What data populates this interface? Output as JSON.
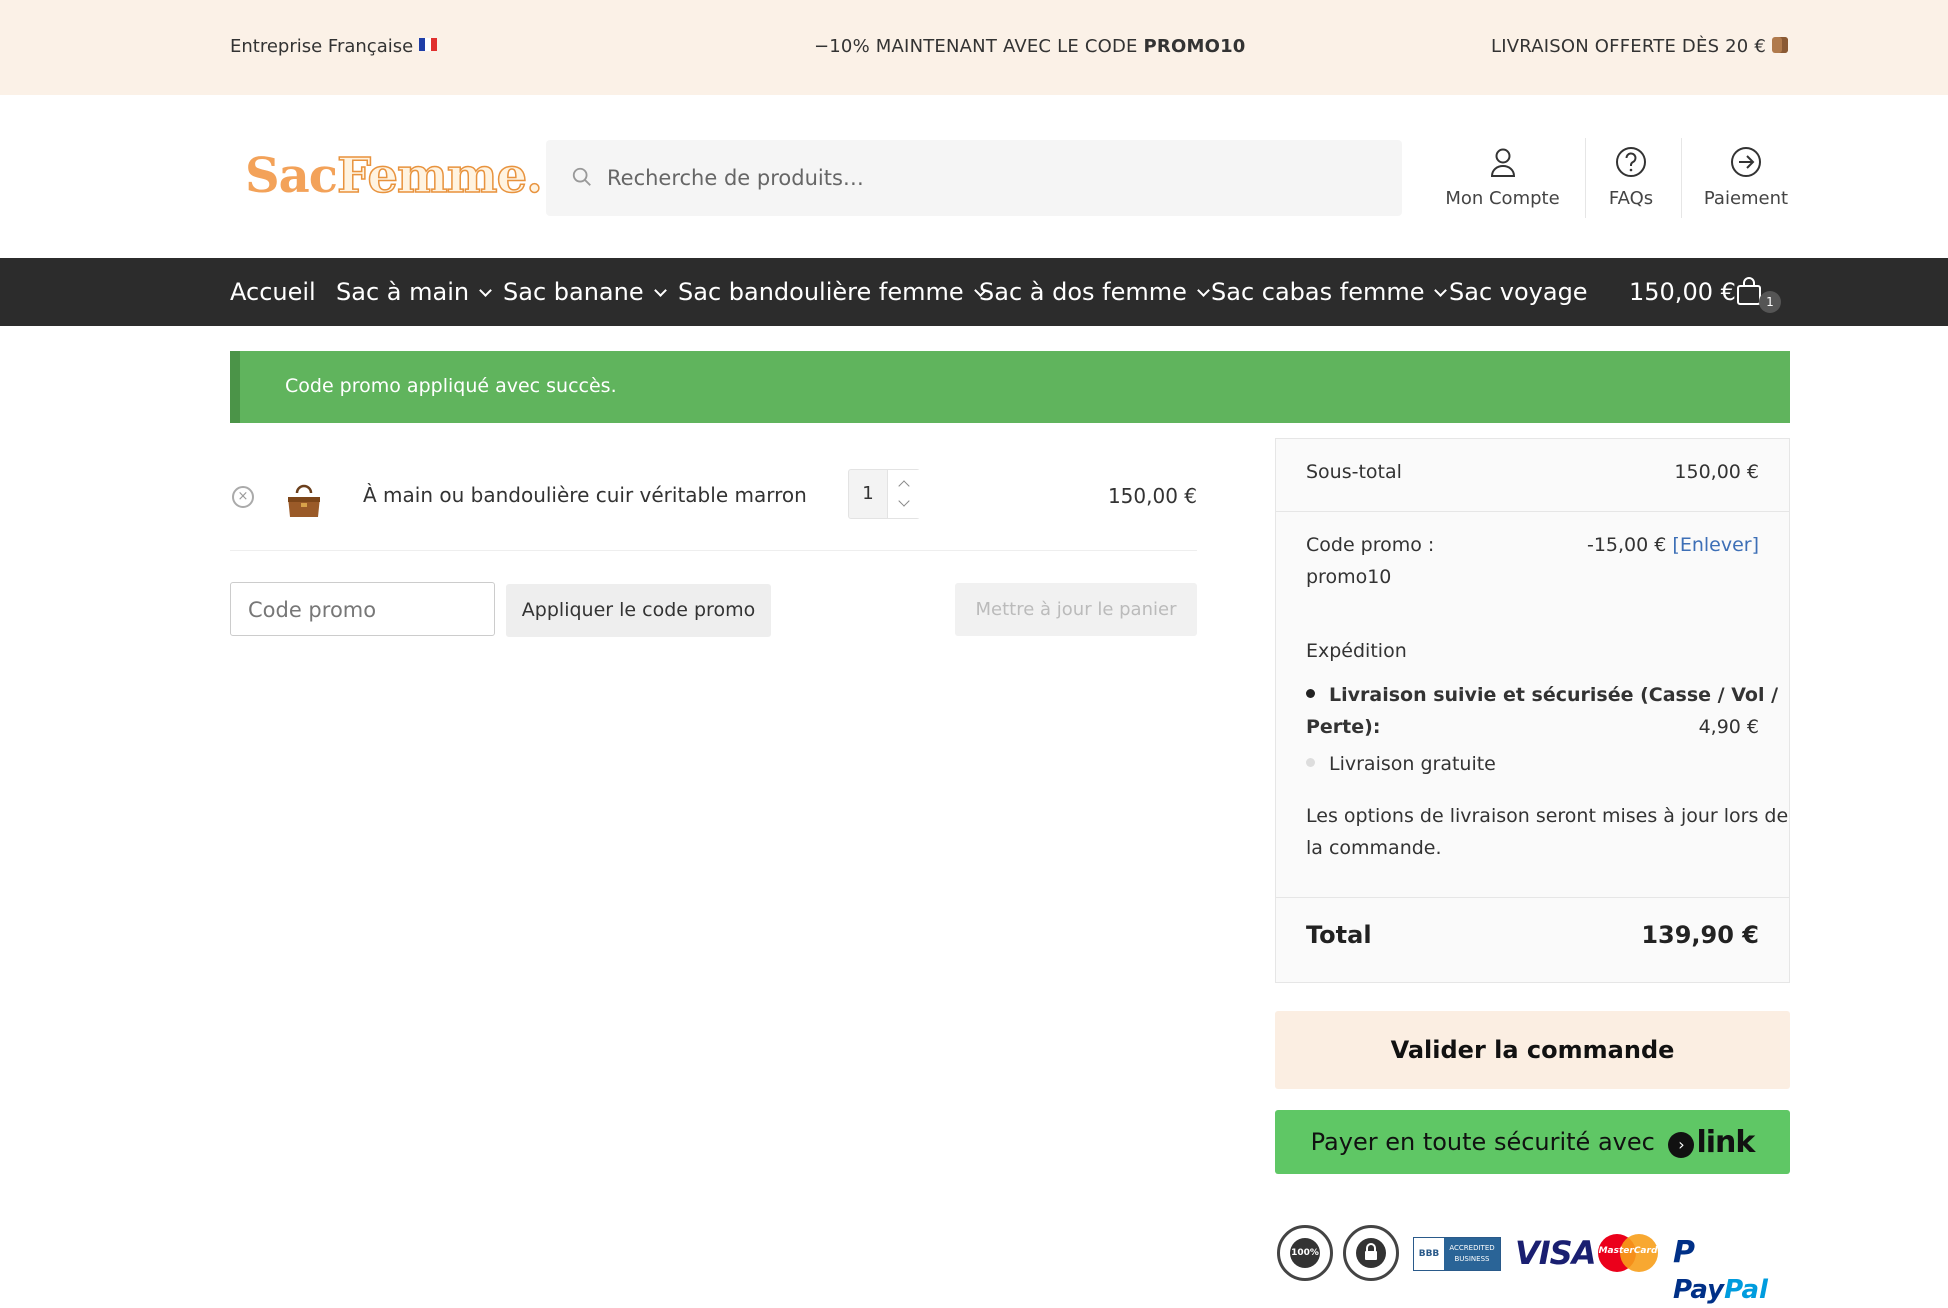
{
  "topbar": {
    "company": "Entreprise Française",
    "promo_prefix": "−10% MAINTENANT AVEC LE CODE ",
    "promo_code": "PROMO10",
    "shipping": "LIVRAISON OFFERTE DÈS 20 €"
  },
  "header": {
    "logo_part1": "Sac",
    "logo_part2": "Femme.",
    "search_placeholder": "Recherche de produits…",
    "account_label": "Mon Compte",
    "faq_label": "FAQs",
    "checkout_label": "Paiement"
  },
  "nav": {
    "items": [
      {
        "label": "Accueil",
        "dropdown": false
      },
      {
        "label": "Sac à main",
        "dropdown": true
      },
      {
        "label": "Sac banane",
        "dropdown": true
      },
      {
        "label": "Sac bandoulière femme",
        "dropdown": true
      },
      {
        "label": "Sac à dos femme",
        "dropdown": true
      },
      {
        "label": "Sac cabas femme",
        "dropdown": true
      },
      {
        "label": "Sac voyage",
        "dropdown": false
      }
    ],
    "cart_total": "150,00 €",
    "cart_count": "1"
  },
  "notice": {
    "message": "Code promo appliqué avec succès."
  },
  "cart": {
    "items": [
      {
        "name": "À main ou bandoulière cuir véritable marron",
        "quantity": "1",
        "price": "150,00 €"
      }
    ],
    "coupon_placeholder": "Code promo",
    "apply_label": "Appliquer le code promo",
    "update_label": "Mettre à jour le panier"
  },
  "totals": {
    "subtotal_label": "Sous-total",
    "subtotal_value": "150,00 €",
    "coupon_label_line1": "Code promo :",
    "coupon_label_line2": "promo10",
    "coupon_value": "-15,00 €",
    "coupon_remove": "[Enlever]",
    "shipping_label": "Expédition",
    "shipping_option1_line1": "Livraison suivie et sécurisée (Casse / Vol /",
    "shipping_option1_line2": "Perte):",
    "shipping_option1_price": "4,90 €",
    "shipping_option2": "Livraison gratuite",
    "shipping_note_line1": "Les options de livraison seront mises à jour lors de",
    "shipping_note_line2": "la commande.",
    "total_label": "Total",
    "total_value": "139,90 €"
  },
  "actions": {
    "checkout_label": "Valider la commande",
    "link_label": "Payer en toute sécurité avec",
    "link_brand": "link"
  },
  "badges": {
    "satisfaction": "100%",
    "bbb_left": "BBB",
    "bbb_right": "ACCREDITED BUSINESS",
    "visa": "VISA",
    "mastercard": "MasterCard",
    "paypal_a": "Pay",
    "paypal_b": "Pal"
  },
  "colors": {
    "topbar_bg": "#fbf1e7",
    "nav_bg": "#2c2c2c",
    "notice_bg": "#60b45d",
    "checkout_bg": "#fbeee2",
    "link_bg": "#5fc765",
    "accent_link": "#3d6fb6",
    "logo": "#f3a259"
  },
  "icons": [
    "flag-fr-icon",
    "package-icon",
    "search-icon",
    "user-icon",
    "help-circle-icon",
    "arrow-circle-right-icon",
    "chevron-down-icon",
    "shopping-bag-icon",
    "close-circle-icon",
    "chevron-up-icon",
    "link-arrow-icon"
  ]
}
